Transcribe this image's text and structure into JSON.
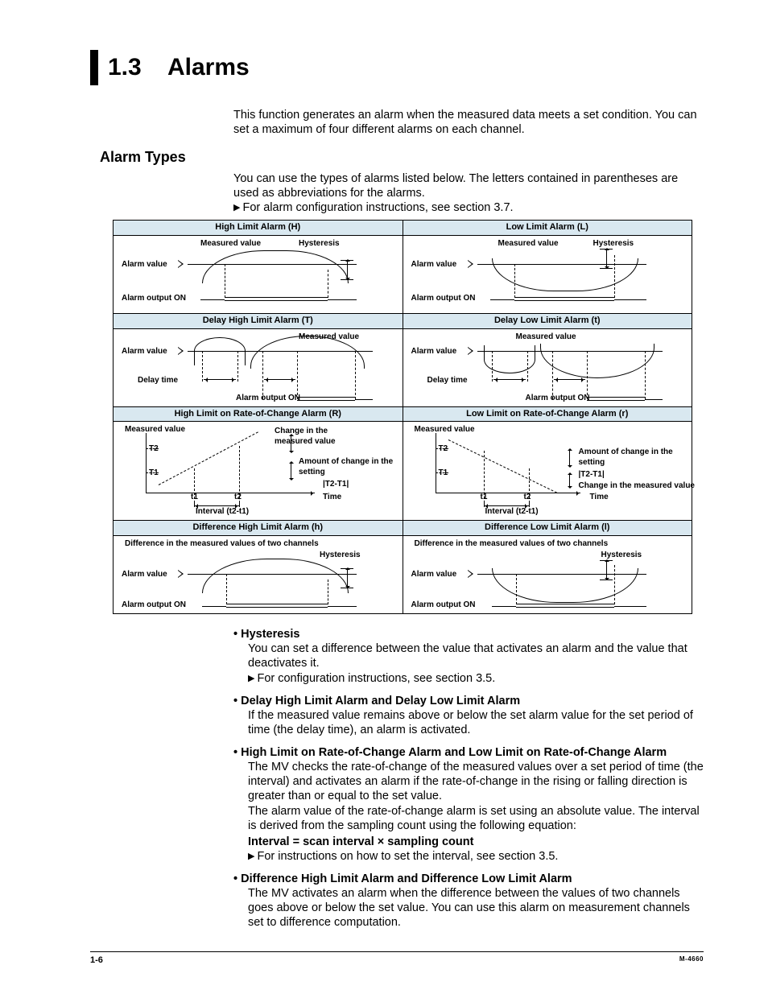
{
  "title_number": "1.3",
  "title_text": "Alarms",
  "intro": "This function generates an alarm when the measured data meets a set condition. You can set a maximum of four different alarms on each channel.",
  "subheading": "Alarm Types",
  "sub_intro": "You can use the types of alarms listed below. The letters contained in parentheses are used as abbreviations for the alarms.",
  "sub_xref": "For alarm configuration instructions, see section 3.7.",
  "diagram": {
    "rows": [
      {
        "left": {
          "title": "High Limit Alarm (H)"
        },
        "right": {
          "title": "Low Limit Alarm (L)"
        }
      },
      {
        "left": {
          "title": "Delay High Limit Alarm (T)"
        },
        "right": {
          "title": "Delay Low Limit Alarm (t)"
        }
      },
      {
        "left": {
          "title": "High Limit on Rate-of-Change Alarm (R)"
        },
        "right": {
          "title": "Low Limit on Rate-of-Change Alarm (r)"
        }
      },
      {
        "left": {
          "title": "Difference High Limit Alarm (h)"
        },
        "right": {
          "title": "Difference Low Limit Alarm (l)"
        }
      }
    ],
    "labels": {
      "measured_value": "Measured value",
      "hysteresis": "Hysteresis",
      "alarm_value": "Alarm value",
      "alarm_output_on": "Alarm output ON",
      "delay_time": "Delay time",
      "change_measured": "Change in the measured value",
      "amount_change_setting": "Amount of change in the setting",
      "t2t1": "|T2-T1|",
      "time": "Time",
      "interval": "Interval (t2-t1)",
      "t1": "t1",
      "t2": "t2",
      "T1": "T1",
      "T2": "T2",
      "diff_two": "Difference in the measured values of two channels"
    }
  },
  "bullets": [
    {
      "head": "Hysteresis",
      "body": "You can set a difference between the value that activates an alarm and the value that deactivates it.",
      "xref": "For configuration instructions, see section 3.5."
    },
    {
      "head": "Delay High Limit Alarm and Delay Low Limit Alarm",
      "body": "If the measured value remains above or below the set alarm value for the set period of time (the delay time), an alarm is activated."
    },
    {
      "head": "High Limit on Rate-of-Change Alarm and Low Limit on Rate-of-Change Alarm",
      "body": "The MV checks the rate-of-change of the measured values over a set period of time (the interval) and activates an alarm if the rate-of-change in the rising or falling direction is greater than or equal to the set value.",
      "body2": "The alarm value of the rate-of-change alarm is set using an absolute value. The interval is derived from the sampling count using the following equation:",
      "equation": "Interval = scan interval × sampling count",
      "xref": "For instructions on how to set the interval, see section 3.5."
    },
    {
      "head": "Difference High Limit Alarm and Difference Low Limit Alarm",
      "body": "The MV activates an alarm when the difference between the values of two channels goes above or below the set value. You can use this alarm on measurement channels set to difference computation."
    }
  ],
  "footer": {
    "page": "1-6",
    "doc": "M-4660"
  }
}
